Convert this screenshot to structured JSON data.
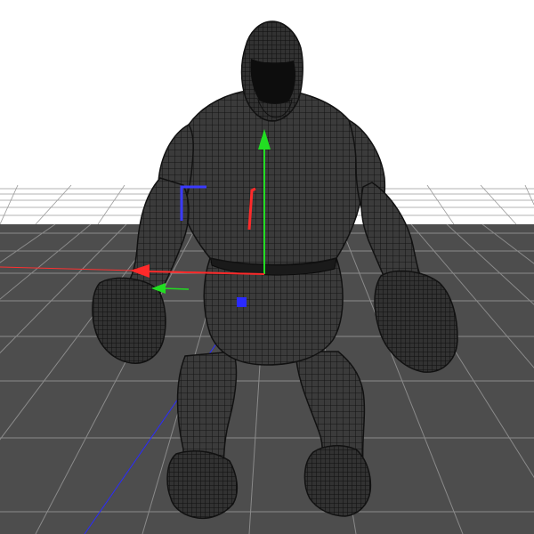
{
  "viewport": {
    "view": "perspective",
    "display_mode": "wireframe-on-shaded",
    "background_color": "#ffffff",
    "floor_color": "#4d4d4d",
    "grid_line_color": "#8a8a8a",
    "mesh_color": "#3a3a3a",
    "wire_color": "#151515"
  },
  "scene_object": {
    "type": "character-mesh",
    "description_icon": "ogre-model-icon"
  },
  "transform_gizmo": {
    "mode": "move",
    "axes": [
      {
        "axis": "x",
        "color": "#ff2a2a",
        "icon": "x-axis-arrow-icon"
      },
      {
        "axis": "y",
        "color": "#22dd22",
        "icon": "y-axis-arrow-icon"
      },
      {
        "axis": "z",
        "color": "#2a2aff",
        "icon": "z-axis-handle-icon"
      }
    ]
  }
}
